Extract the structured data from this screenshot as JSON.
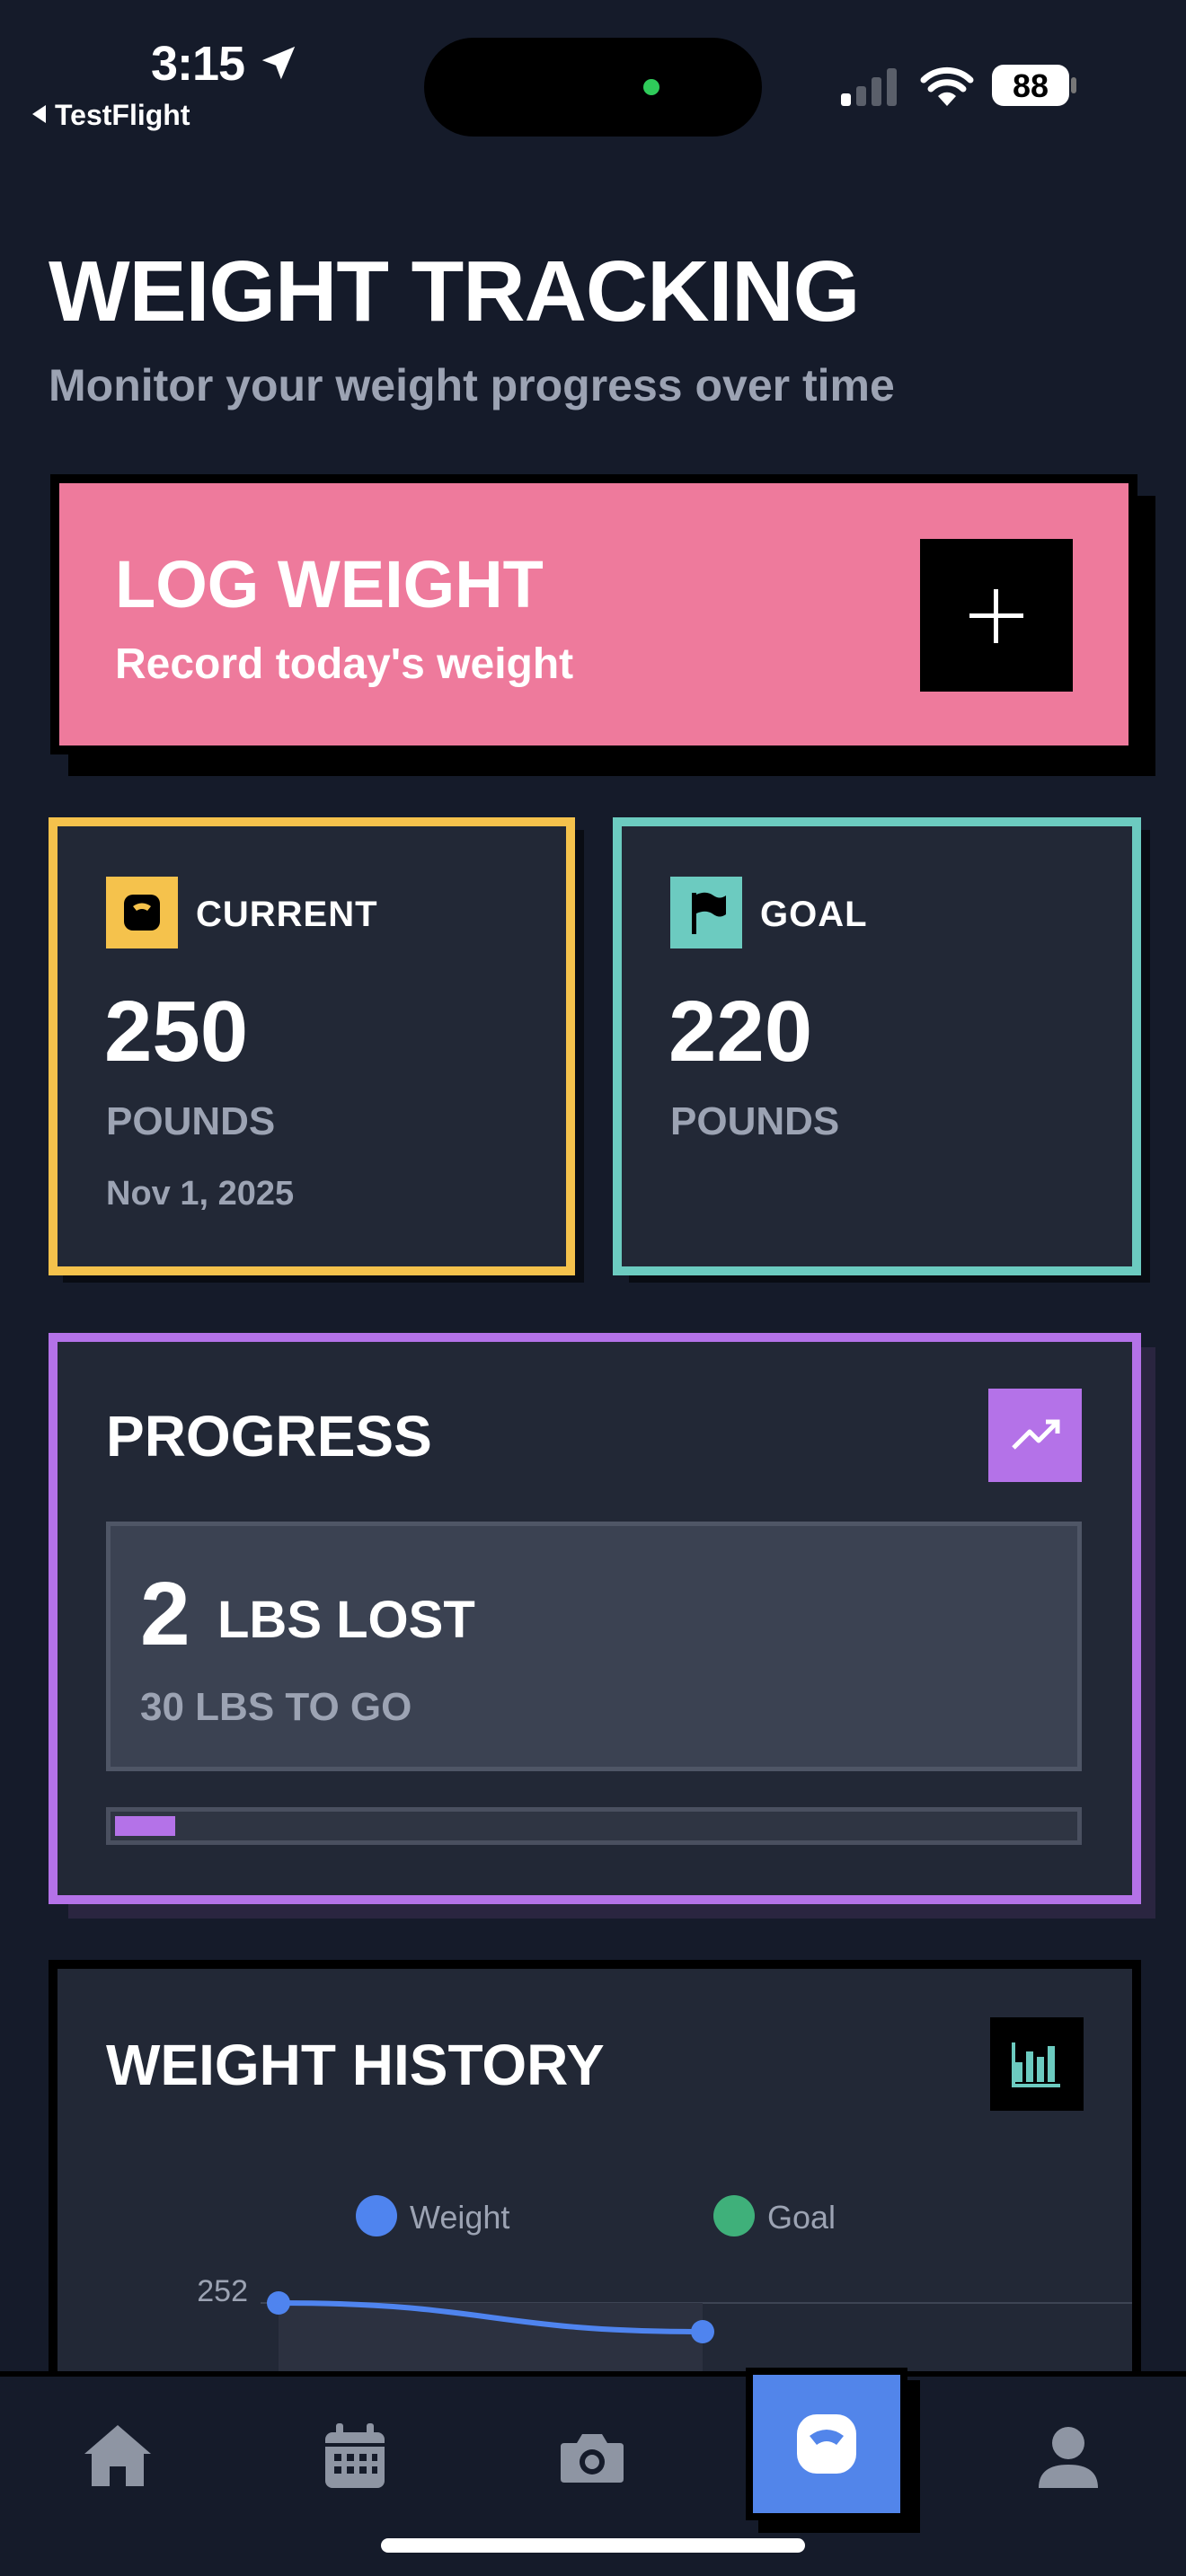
{
  "status_bar": {
    "time": "3:15",
    "back_app": "TestFlight",
    "battery": "88"
  },
  "header": {
    "title": "WEIGHT TRACKING",
    "subtitle": "Monitor your weight progress over time"
  },
  "log_weight": {
    "title": "LOG WEIGHT",
    "subtitle": "Record today's weight",
    "button_icon": "plus-icon"
  },
  "current": {
    "label": "CURRENT",
    "value": "250",
    "unit": "POUNDS",
    "date": "Nov 1, 2025",
    "icon": "scale-icon",
    "color": "#f5c24c"
  },
  "goal": {
    "label": "GOAL",
    "value": "220",
    "unit": "POUNDS",
    "icon": "flag-icon",
    "color": "#6ccbc0"
  },
  "progress": {
    "title": "PROGRESS",
    "icon": "trending-up-icon",
    "lost_value": "2",
    "lost_unit": "LBS LOST",
    "to_go": "30 LBS TO GO",
    "fraction": 0.0625,
    "color": "#b472e8"
  },
  "history": {
    "title": "WEIGHT HISTORY",
    "icon": "bar-chart-icon",
    "legend": [
      {
        "label": "Weight",
        "color": "#4f84ef"
      },
      {
        "label": "Goal",
        "color": "#3fb07a"
      }
    ],
    "y_tick": "252"
  },
  "chart_data": {
    "type": "line",
    "y_ticks": [
      252
    ],
    "series": [
      {
        "name": "Weight",
        "values": [
          252,
          251
        ]
      },
      {
        "name": "Goal",
        "values": []
      }
    ]
  },
  "tabbar": {
    "items": [
      {
        "name": "home",
        "icon": "home-icon"
      },
      {
        "name": "calendar",
        "icon": "calendar-icon"
      },
      {
        "name": "camera",
        "icon": "camera-icon"
      },
      {
        "name": "weight",
        "icon": "scale-icon",
        "active": true
      },
      {
        "name": "profile",
        "icon": "person-icon"
      }
    ],
    "active_color": "#5285ea"
  }
}
